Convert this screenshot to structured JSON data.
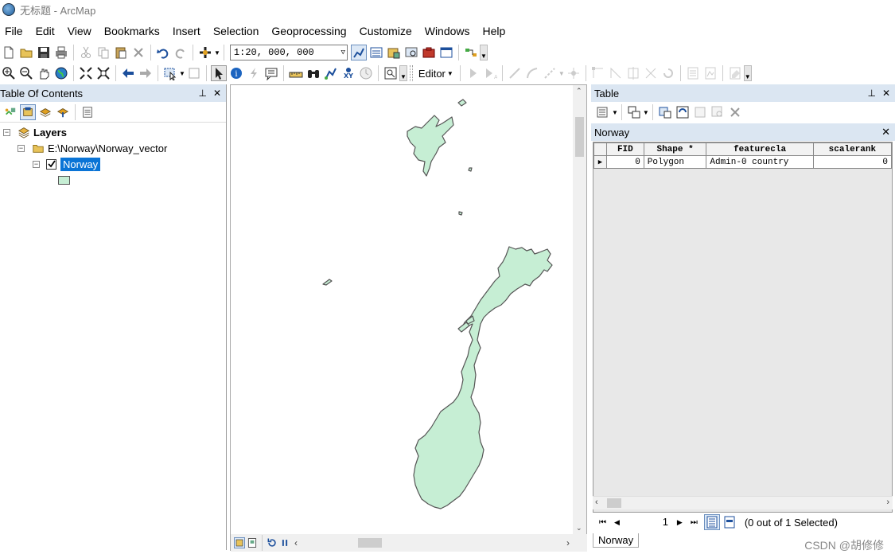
{
  "window": {
    "title": "无标题 - ArcMap"
  },
  "menu": [
    "File",
    "Edit",
    "View",
    "Bookmarks",
    "Insert",
    "Selection",
    "Geoprocessing",
    "Customize",
    "Windows",
    "Help"
  ],
  "toolbar": {
    "scale": "1:20, 000, 000",
    "editor_label": "Editor"
  },
  "toc": {
    "title": "Table Of Contents",
    "root": "Layers",
    "folder": "E:\\Norway\\Norway_vector",
    "layer": "Norway",
    "layer_checked": true,
    "symbol_color": "#c6eed4"
  },
  "map": {
    "fill": "#c6eed4",
    "stroke": "#555555"
  },
  "table": {
    "title": "Table",
    "layer_tab": "Norway",
    "columns": [
      "FID",
      "Shape *",
      "featurecla",
      "scalerank"
    ],
    "rows": [
      [
        "0",
        "Polygon",
        "Admin-0 country",
        "0"
      ]
    ],
    "record": "1",
    "selection_status": "(0 out of 1 Selected)"
  },
  "watermark": "CSDN @胡修修"
}
